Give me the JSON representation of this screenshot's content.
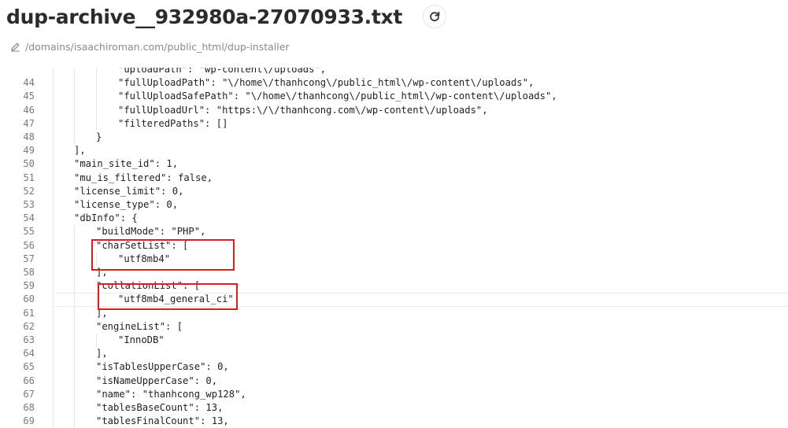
{
  "header": {
    "title": "dup-archive__932980a-27070933.txt",
    "path": "/domains/isaachiroman.com/public_html/dup-installer"
  },
  "icons": {
    "refresh": "refresh-icon",
    "edit_path": "pencil-icon"
  },
  "colors": {
    "highlight_box": "#d81d1d",
    "line_number": "#7a7a7a",
    "path_text": "#8a8a8a"
  },
  "editor": {
    "lines": [
      {
        "n": "",
        "indent": 2,
        "text": "\"uploadPath\": \"wp-content\\/uploads\","
      },
      {
        "n": "44",
        "indent": 2,
        "text": "\"fullUploadPath\": \"\\/home\\/thanhcong\\/public_html\\/wp-content\\/uploads\","
      },
      {
        "n": "45",
        "indent": 2,
        "text": "\"fullUploadSafePath\": \"\\/home\\/thanhcong\\/public_html\\/wp-content\\/uploads\","
      },
      {
        "n": "46",
        "indent": 2,
        "text": "\"fullUploadUrl\": \"https:\\/\\/thanhcong.com\\/wp-content\\/uploads\","
      },
      {
        "n": "47",
        "indent": 2,
        "text": "\"filteredPaths\": []"
      },
      {
        "n": "48",
        "indent": 1,
        "text": "}"
      },
      {
        "n": "49",
        "indent": 0,
        "text": "],"
      },
      {
        "n": "50",
        "indent": 0,
        "text": "\"main_site_id\": 1,"
      },
      {
        "n": "51",
        "indent": 0,
        "text": "\"mu_is_filtered\": false,"
      },
      {
        "n": "52",
        "indent": 0,
        "text": "\"license_limit\": 0,"
      },
      {
        "n": "53",
        "indent": 0,
        "text": "\"license_type\": 0,"
      },
      {
        "n": "54",
        "indent": 0,
        "text": "\"dbInfo\": {"
      },
      {
        "n": "55",
        "indent": 1,
        "text": "\"buildMode\": \"PHP\","
      },
      {
        "n": "56",
        "indent": 1,
        "text": "\"charSetList\": ["
      },
      {
        "n": "57",
        "indent": 2,
        "text": "\"utf8mb4\""
      },
      {
        "n": "58",
        "indent": 1,
        "text": "],"
      },
      {
        "n": "59",
        "indent": 1,
        "text": "\"collationList\": ["
      },
      {
        "n": "60",
        "indent": 2,
        "text": "\"utf8mb4_general_ci\"",
        "active": true
      },
      {
        "n": "61",
        "indent": 1,
        "text": "],"
      },
      {
        "n": "62",
        "indent": 1,
        "text": "\"engineList\": ["
      },
      {
        "n": "63",
        "indent": 2,
        "text": "\"InnoDB\""
      },
      {
        "n": "64",
        "indent": 1,
        "text": "],"
      },
      {
        "n": "65",
        "indent": 1,
        "text": "\"isTablesUpperCase\": 0,"
      },
      {
        "n": "66",
        "indent": 1,
        "text": "\"isNameUpperCase\": 0,"
      },
      {
        "n": "67",
        "indent": 1,
        "text": "\"name\": \"thanhcong_wp128\","
      },
      {
        "n": "68",
        "indent": 1,
        "text": "\"tablesBaseCount\": 13,"
      },
      {
        "n": "69",
        "indent": 1,
        "text": "\"tablesFinalCount\": 13,"
      }
    ]
  }
}
